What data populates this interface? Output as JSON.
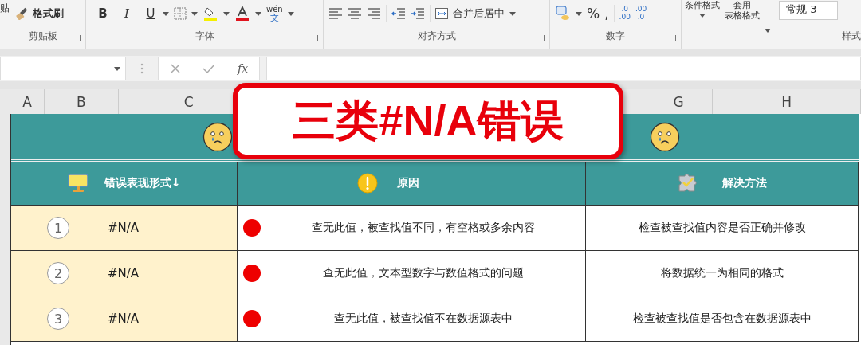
{
  "ribbon": {
    "clipboard": {
      "paste_label": "贴",
      "format_painter": "格式刷",
      "group_label": "剪贴板"
    },
    "font": {
      "style_buttons": [
        "B",
        "I",
        "U"
      ],
      "phonetic_top": "wén",
      "phonetic_bottom": "文",
      "group_label": "字体"
    },
    "alignment": {
      "merge_button": "合并后居中",
      "group_label": "对齐方式"
    },
    "number": {
      "percent_button": "%",
      "comma_button": ",",
      "decimal_buttons": [
        {
          "top": ".0",
          "bottom": ".00"
        },
        {
          "top": ".00",
          "bottom": ".0"
        }
      ],
      "group_label": "数字"
    },
    "styles": {
      "conditional_format": "条件格式",
      "table_format": [
        "套用",
        "表格格式"
      ],
      "cell_style": "常规 3",
      "group_label": "样式"
    }
  },
  "formula_bar": {
    "function_label": "fx"
  },
  "column_headers": [
    "A",
    "B",
    "C",
    "G",
    "H"
  ],
  "table": {
    "title": "三类#N/A错误",
    "columns": [
      "错误表现形式↓",
      "原因",
      "解决方法"
    ],
    "rows": [
      {
        "number": "1",
        "error": "#N/A",
        "cause": "查无此值，被查找值不同，有空格或多余内容",
        "solution": "检查被查找值内容是否正确并修改"
      },
      {
        "number": "2",
        "error": "#N/A",
        "cause": "查无此值，文本型数字与数值格式的问题",
        "solution": "将数据统一为相同的格式"
      },
      {
        "number": "3",
        "error": "#N/A",
        "cause": "查无此值，被查找值不在数据源表中",
        "solution": "检查被查找值是否包含在数据源表中"
      }
    ]
  }
}
